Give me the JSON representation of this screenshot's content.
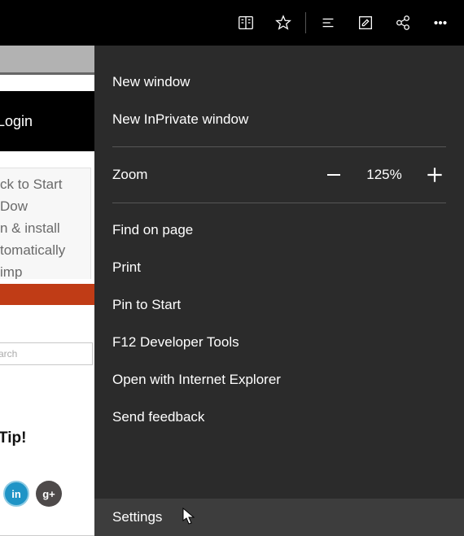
{
  "toolbar": {
    "icons": [
      "reading-list",
      "favorites",
      "hub",
      "webnote",
      "share",
      "more"
    ]
  },
  "page": {
    "login_label": "Login",
    "snippet_line1": "ck to Start Dow",
    "snippet_line2": "n & install",
    "snippet_line3": "tomatically imp",
    "search_placeholder": "arch",
    "tip_label": "Tip!",
    "social_labels": {
      "linkedin": "in",
      "gplus": "g+"
    }
  },
  "menu": {
    "new_window": "New window",
    "new_inprivate": "New InPrivate window",
    "zoom_label": "Zoom",
    "zoom_value": "125%",
    "find": "Find on page",
    "print": "Print",
    "pin": "Pin to Start",
    "devtools": "F12 Developer Tools",
    "open_ie": "Open with Internet Explorer",
    "feedback": "Send feedback",
    "settings": "Settings"
  }
}
